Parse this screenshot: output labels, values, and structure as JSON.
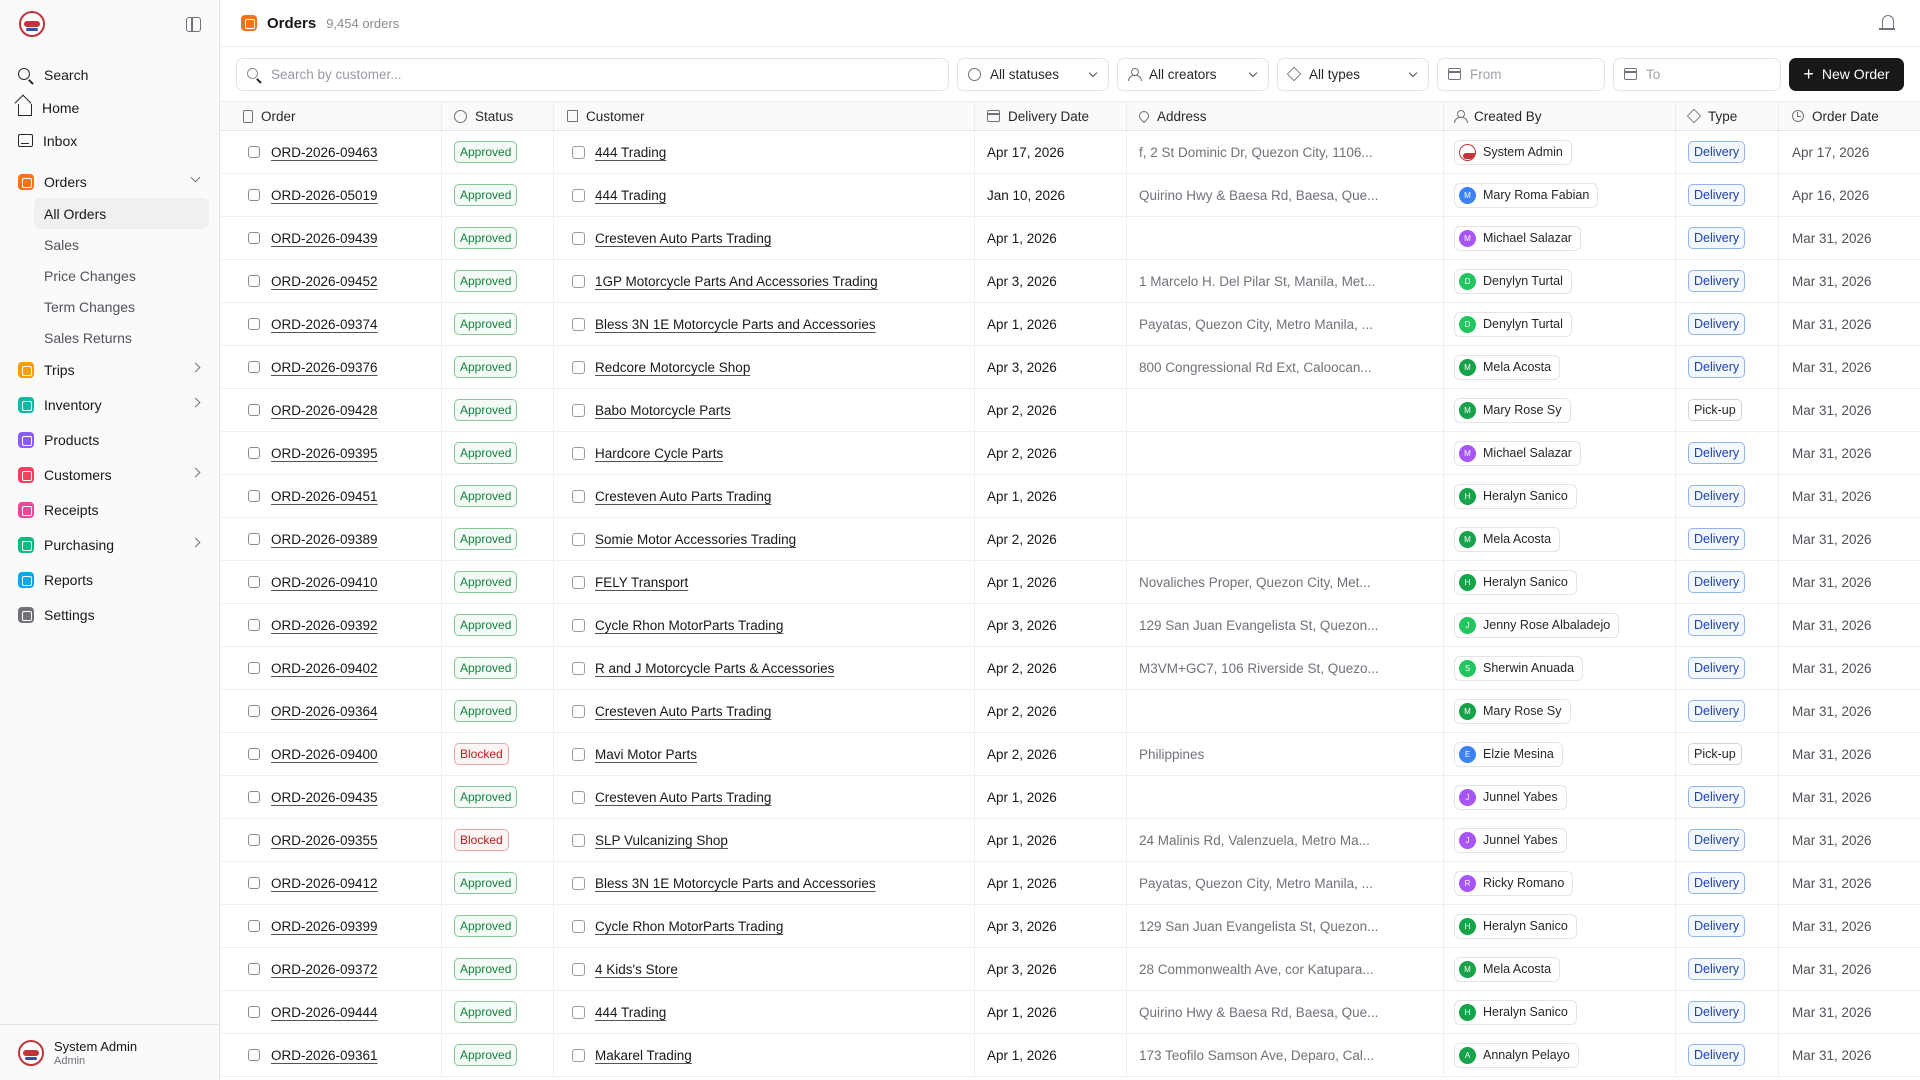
{
  "sidebar": {
    "nav": [
      {
        "label": "Search"
      },
      {
        "label": "Home"
      },
      {
        "label": "Inbox"
      }
    ],
    "orders": {
      "label": "Orders",
      "sub": [
        "All Orders",
        "Sales",
        "Price Changes",
        "Term Changes",
        "Sales Returns"
      ]
    },
    "modules": [
      {
        "label": "Trips",
        "color": "#f59e0b",
        "chevron": true
      },
      {
        "label": "Inventory",
        "color": "#14b8a6",
        "chevron": true
      },
      {
        "label": "Products",
        "color": "#8b5cf6",
        "chevron": false
      },
      {
        "label": "Customers",
        "color": "#f43f5e",
        "chevron": true
      },
      {
        "label": "Receipts",
        "color": "#ec4899",
        "chevron": false
      },
      {
        "label": "Purchasing",
        "color": "#10b981",
        "chevron": true
      },
      {
        "label": "Reports",
        "color": "#0ea5e9",
        "chevron": false
      },
      {
        "label": "Settings",
        "color": "#71717a",
        "chevron": false
      }
    ],
    "user": {
      "name": "System Admin",
      "role": "Admin"
    }
  },
  "header": {
    "title": "Orders",
    "count": "9,454 orders",
    "accent": "#f97316"
  },
  "toolbar": {
    "search_placeholder": "Search by customer...",
    "status_filter": "All statuses",
    "creator_filter": "All creators",
    "type_filter": "All types",
    "from_placeholder": "From",
    "to_placeholder": "To",
    "new_order_label": "New Order"
  },
  "columns": [
    "Order",
    "Status",
    "Customer",
    "Delivery Date",
    "Address",
    "Created By",
    "Type",
    "Order Date"
  ],
  "rows": [
    {
      "order": "ORD-2026-09463",
      "status": "Approved",
      "customer": "444 Trading",
      "delivery": "Apr 17, 2026",
      "address": "f, 2 St Dominic Dr, Quezon City, 1106...",
      "by": "System Admin",
      "initial": "",
      "avcolor": "logo",
      "type": "Delivery",
      "date": "Apr 17, 2026"
    },
    {
      "order": "ORD-2026-05019",
      "status": "Approved",
      "customer": "444 Trading",
      "delivery": "Jan 10, 2026",
      "address": "Quirino Hwy & Baesa Rd, Baesa, Que...",
      "by": "Mary Roma Fabian",
      "initial": "M",
      "avcolor": "#3b82f6",
      "type": "Delivery",
      "date": "Apr 16, 2026"
    },
    {
      "order": "ORD-2026-09439",
      "status": "Approved",
      "customer": "Cresteven Auto Parts Trading",
      "delivery": "Apr 1, 2026",
      "address": "",
      "by": "Michael Salazar",
      "initial": "M",
      "avcolor": "#a855f7",
      "type": "Delivery",
      "date": "Mar 31, 2026"
    },
    {
      "order": "ORD-2026-09452",
      "status": "Approved",
      "customer": "1GP Motorcycle Parts And Accessories Trading",
      "delivery": "Apr 3, 2026",
      "address": "1 Marcelo H. Del Pilar St, Manila, Met...",
      "by": "Denylyn Turtal",
      "initial": "D",
      "avcolor": "#22c55e",
      "type": "Delivery",
      "date": "Mar 31, 2026"
    },
    {
      "order": "ORD-2026-09374",
      "status": "Approved",
      "customer": "Bless 3N 1E Motorcycle Parts and Accessories",
      "delivery": "Apr 1, 2026",
      "address": "Payatas, Quezon City, Metro Manila, ...",
      "by": "Denylyn Turtal",
      "initial": "D",
      "avcolor": "#22c55e",
      "type": "Delivery",
      "date": "Mar 31, 2026"
    },
    {
      "order": "ORD-2026-09376",
      "status": "Approved",
      "customer": "Redcore Motorcycle Shop",
      "delivery": "Apr 3, 2026",
      "address": "800 Congressional Rd Ext, Caloocan...",
      "by": "Mela Acosta",
      "initial": "M",
      "avcolor": "#16a34a",
      "type": "Delivery",
      "date": "Mar 31, 2026"
    },
    {
      "order": "ORD-2026-09428",
      "status": "Approved",
      "customer": "Babo Motorcycle Parts",
      "delivery": "Apr 2, 2026",
      "address": "",
      "by": "Mary Rose Sy",
      "initial": "M",
      "avcolor": "#16a34a",
      "type": "Pick-up",
      "date": "Mar 31, 2026"
    },
    {
      "order": "ORD-2026-09395",
      "status": "Approved",
      "customer": "Hardcore Cycle Parts",
      "delivery": "Apr 2, 2026",
      "address": "",
      "by": "Michael Salazar",
      "initial": "M",
      "avcolor": "#a855f7",
      "type": "Delivery",
      "date": "Mar 31, 2026"
    },
    {
      "order": "ORD-2026-09451",
      "status": "Approved",
      "customer": "Cresteven Auto Parts Trading",
      "delivery": "Apr 1, 2026",
      "address": "",
      "by": "Heralyn Sanico",
      "initial": "H",
      "avcolor": "#16a34a",
      "type": "Delivery",
      "date": "Mar 31, 2026"
    },
    {
      "order": "ORD-2026-09389",
      "status": "Approved",
      "customer": "Somie Motor Accessories Trading",
      "delivery": "Apr 2, 2026",
      "address": "",
      "by": "Mela Acosta",
      "initial": "M",
      "avcolor": "#16a34a",
      "type": "Delivery",
      "date": "Mar 31, 2026"
    },
    {
      "order": "ORD-2026-09410",
      "status": "Approved",
      "customer": "FELY Transport",
      "delivery": "Apr 1, 2026",
      "address": "Novaliches Proper, Quezon City, Met...",
      "by": "Heralyn Sanico",
      "initial": "H",
      "avcolor": "#16a34a",
      "type": "Delivery",
      "date": "Mar 31, 2026"
    },
    {
      "order": "ORD-2026-09392",
      "status": "Approved",
      "customer": "Cycle Rhon MotorParts Trading",
      "delivery": "Apr 3, 2026",
      "address": "129 San Juan Evangelista St, Quezon...",
      "by": "Jenny Rose Albaladejo",
      "initial": "J",
      "avcolor": "#22c55e",
      "type": "Delivery",
      "date": "Mar 31, 2026"
    },
    {
      "order": "ORD-2026-09402",
      "status": "Approved",
      "customer": "R and J Motorcycle Parts & Accessories",
      "delivery": "Apr 2, 2026",
      "address": "M3VM+GC7, 106 Riverside St, Quezo...",
      "by": "Sherwin Anuada",
      "initial": "S",
      "avcolor": "#22c55e",
      "type": "Delivery",
      "date": "Mar 31, 2026"
    },
    {
      "order": "ORD-2026-09364",
      "status": "Approved",
      "customer": "Cresteven Auto Parts Trading",
      "delivery": "Apr 2, 2026",
      "address": "",
      "by": "Mary Rose Sy",
      "initial": "M",
      "avcolor": "#16a34a",
      "type": "Delivery",
      "date": "Mar 31, 2026"
    },
    {
      "order": "ORD-2026-09400",
      "status": "Blocked",
      "customer": "Mavi Motor Parts",
      "delivery": "Apr 2, 2026",
      "address": "Philippines",
      "by": "Elzie Mesina",
      "initial": "E",
      "avcolor": "#3b82f6",
      "type": "Pick-up",
      "date": "Mar 31, 2026"
    },
    {
      "order": "ORD-2026-09435",
      "status": "Approved",
      "customer": "Cresteven Auto Parts Trading",
      "delivery": "Apr 1, 2026",
      "address": "",
      "by": "Junnel Yabes",
      "initial": "J",
      "avcolor": "#a855f7",
      "type": "Delivery",
      "date": "Mar 31, 2026"
    },
    {
      "order": "ORD-2026-09355",
      "status": "Blocked",
      "customer": "SLP Vulcanizing Shop",
      "delivery": "Apr 1, 2026",
      "address": "24 Malinis Rd, Valenzuela, Metro Ma...",
      "by": "Junnel Yabes",
      "initial": "J",
      "avcolor": "#a855f7",
      "type": "Delivery",
      "date": "Mar 31, 2026"
    },
    {
      "order": "ORD-2026-09412",
      "status": "Approved",
      "customer": "Bless 3N 1E Motorcycle Parts and Accessories",
      "delivery": "Apr 1, 2026",
      "address": "Payatas, Quezon City, Metro Manila, ...",
      "by": "Ricky Romano",
      "initial": "R",
      "avcolor": "#a855f7",
      "type": "Delivery",
      "date": "Mar 31, 2026"
    },
    {
      "order": "ORD-2026-09399",
      "status": "Approved",
      "customer": "Cycle Rhon MotorParts Trading",
      "delivery": "Apr 3, 2026",
      "address": "129 San Juan Evangelista St, Quezon...",
      "by": "Heralyn Sanico",
      "initial": "H",
      "avcolor": "#16a34a",
      "type": "Delivery",
      "date": "Mar 31, 2026"
    },
    {
      "order": "ORD-2026-09372",
      "status": "Approved",
      "customer": "4 Kids's Store",
      "delivery": "Apr 3, 2026",
      "address": "28 Commonwealth Ave, cor Katupara...",
      "by": "Mela Acosta",
      "initial": "M",
      "avcolor": "#16a34a",
      "type": "Delivery",
      "date": "Mar 31, 2026"
    },
    {
      "order": "ORD-2026-09444",
      "status": "Approved",
      "customer": "444 Trading",
      "delivery": "Apr 1, 2026",
      "address": "Quirino Hwy & Baesa Rd, Baesa, Que...",
      "by": "Heralyn Sanico",
      "initial": "H",
      "avcolor": "#16a34a",
      "type": "Delivery",
      "date": "Mar 31, 2026"
    },
    {
      "order": "ORD-2026-09361",
      "status": "Approved",
      "customer": "Makarel Trading",
      "delivery": "Apr 1, 2026",
      "address": "173 Teofilo Samson Ave, Deparo, Cal...",
      "by": "Annalyn Pelayo",
      "initial": "A",
      "avcolor": "#16a34a",
      "type": "Delivery",
      "date": "Mar 31, 2026"
    }
  ]
}
